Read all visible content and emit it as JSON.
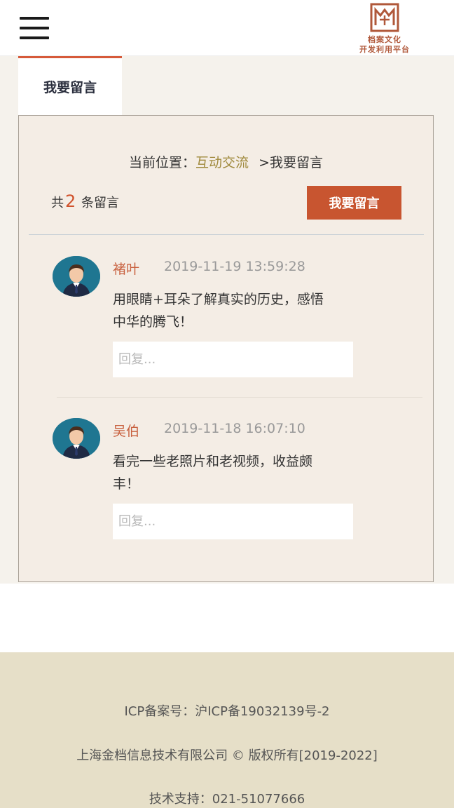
{
  "header": {
    "menu_icon": "hamburger-icon",
    "logo_line1": "档案文化",
    "logo_line2": "开发利用平台"
  },
  "tabs": [
    {
      "label": "我要留言",
      "active": true
    }
  ],
  "breadcrumb": {
    "prefix": "当前位置：",
    "link": "互动交流",
    "separator": ">",
    "current": "我要留言"
  },
  "summary": {
    "prefix": "共",
    "count": "2",
    "suffix": "条留言"
  },
  "leave_button": "我要留言",
  "messages": [
    {
      "author": "褚叶",
      "time": "2019-11-19 13:59:28",
      "text": "用眼睛+耳朵了解真实的历史，感悟中华的腾飞！",
      "reply_placeholder": "回复..."
    },
    {
      "author": "吴伯",
      "time": "2019-11-18 16:07:10",
      "text": "看完一些老照片和老视频，收益颇丰！",
      "reply_placeholder": "回复..."
    }
  ],
  "footer": {
    "icp": "ICP备案号：沪ICP备19032139号-2",
    "copyright": "上海金档信息技术有限公司 © 版权所有[2019-2022]",
    "support": "技术支持：021-51077666"
  },
  "colors": {
    "accent": "#c85530",
    "link": "#a08a3d",
    "footer_bg": "#e6dfc8",
    "panel_bg": "#f4ede5"
  }
}
